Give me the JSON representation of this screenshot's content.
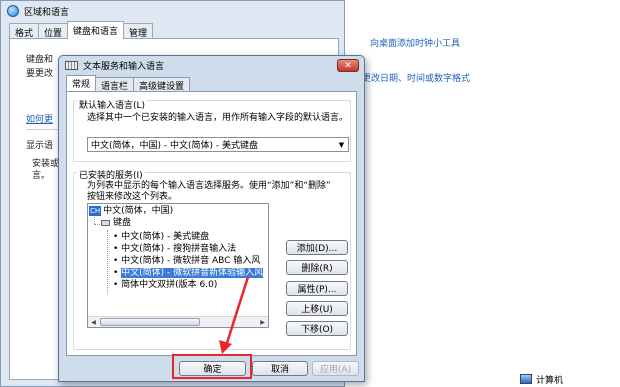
{
  "control_panel": {
    "link_gadget": "向桌面添加时钟小工具",
    "link_datetime": "更改日期、时间或数字格式",
    "taskbar_computer": "计算机"
  },
  "region_dialog": {
    "title": "区域和语言",
    "tabs": [
      "格式",
      "位置",
      "键盘和语言",
      "管理"
    ],
    "body_label1": "键盘和",
    "body_text1": "要更改",
    "body_link": "如何更",
    "body_label2": "显示语",
    "body_text2a": "安装或",
    "body_text2b": "言。"
  },
  "dialog": {
    "title": "文本服务和输入语言",
    "close_glyph": "✕",
    "tabs": [
      "常规",
      "语言栏",
      "高级键设置"
    ],
    "default_lang_label": "默认输入语言(L)",
    "default_lang_desc": "选择其中一个已安装的输入语言，用作所有输入字段的默认语言。",
    "default_lang_value": "中文(简体，中国) - 中文(简体) - 美式键盘",
    "installed_label": "已安装的服务(I)",
    "installed_desc1": "为列表中显示的每个输入语言选择服务。使用“添加”和“删除”",
    "installed_desc2": "按钮来修改这个列表。",
    "tree": {
      "lang_badge": "CH",
      "lang": "中文(简体，中国)",
      "keyboard": "键盘",
      "items": [
        "中文(简体) - 美式键盘",
        "中文(简体) - 搜狗拼音输入法",
        "中文(简体) - 微软拼音 ABC 输入风",
        "中文(简体) - 微软拼音新体验输入风",
        "简体中文双拼(版本 6.0)"
      ]
    },
    "buttons": {
      "add": "添加(D)...",
      "remove": "删除(R)",
      "properties": "属性(P)...",
      "move_up": "上移(U)",
      "move_down": "下移(O)",
      "ok": "确定",
      "cancel": "取消",
      "apply": "应用(A)"
    }
  }
}
